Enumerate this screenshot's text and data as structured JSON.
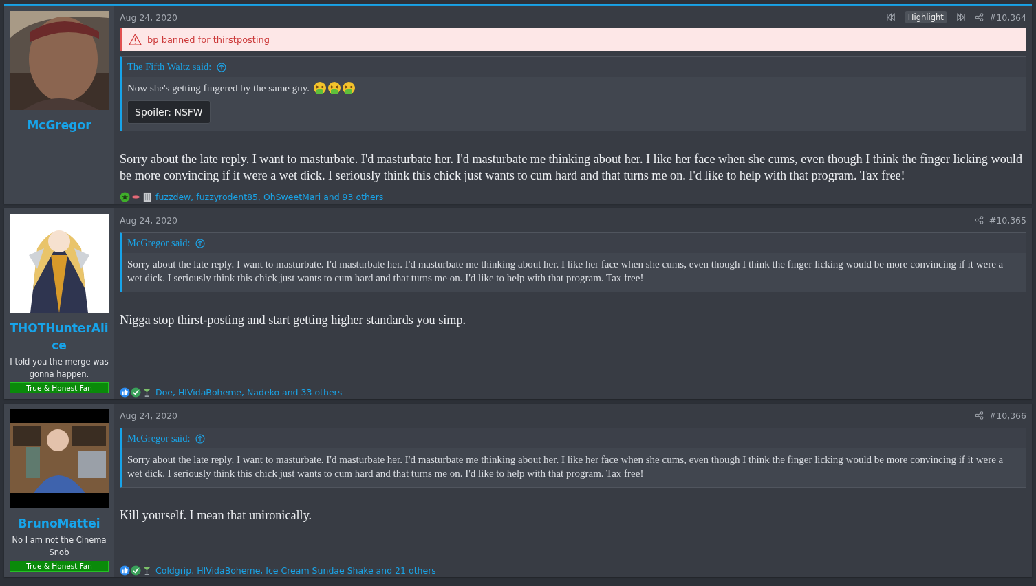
{
  "posts": [
    {
      "user": {
        "name": "McGregor"
      },
      "date": "Aug 24, 2020",
      "highlight": {
        "label": "Highlight"
      },
      "number": "#10,364",
      "notice": {
        "text": "bp banned for thirstposting"
      },
      "quote": {
        "author": "The Fifth Waltz said:",
        "text": "Now she's getting fingered by the same guy.",
        "emojis": [
          {
            "kind": "vomit"
          },
          {
            "kind": "vomit"
          },
          {
            "kind": "vomit"
          }
        ],
        "spoiler": "Spoiler: NSFW"
      },
      "body": "Sorry about the late reply. I want to masturbate. I'd masturbate her. I'd masturbate me thinking about her. I like her face when she cums, even though I think the finger licking would be more convincing if it were a wet dick. I seriously think this chick just wants to cum hard and that turns me on. I'd like to help with that program. Tax free!",
      "reactions": {
        "icons": [
          {
            "kind": "star"
          },
          {
            "kind": "lips"
          },
          {
            "kind": "door"
          }
        ],
        "text": "fuzzdew, fuzzyrodent85, OhSweetMari and 93 others"
      }
    },
    {
      "user": {
        "name": "THOTHunterAlice",
        "title": "I told you the merge was gonna happen.",
        "banner": "True & Honest Fan"
      },
      "date": "Aug 24, 2020",
      "number": "#10,365",
      "quote": {
        "author": "McGregor said:",
        "text": "Sorry about the late reply. I want to masturbate. I'd masturbate her. I'd masturbate me thinking about her. I like her face when she cums, even though I think the finger licking would be more convincing if it were a wet dick. I seriously think this chick just wants to cum hard and that turns me on. I'd like to help with that program. Tax free!"
      },
      "body": "Nigga stop thirst-posting and start getting higher standards you simp.",
      "reactions": {
        "icons": [
          {
            "kind": "like"
          },
          {
            "kind": "check"
          },
          {
            "kind": "cocktail"
          }
        ],
        "text": "Doe, HIVidaBoheme, Nadeko and 33 others"
      }
    },
    {
      "user": {
        "name": "BrunoMattei",
        "title": "No I am not the Cinema Snob",
        "banner": "True & Honest Fan"
      },
      "date": "Aug 24, 2020",
      "number": "#10,366",
      "quote": {
        "author": "McGregor said:",
        "text": "Sorry about the late reply. I want to masturbate. I'd masturbate her. I'd masturbate me thinking about her. I like her face when she cums, even though I think the finger licking would be more convincing if it were a wet dick. I seriously think this chick just wants to cum hard and that turns me on. I'd like to help with that program. Tax free!"
      },
      "body": "Kill yourself. I mean that unironically.",
      "reactions": {
        "icons": [
          {
            "kind": "like"
          },
          {
            "kind": "check"
          },
          {
            "kind": "cocktail"
          }
        ],
        "text": "Coldgrip, HIVidaBoheme, Ice Cream Sundae Shake and 21 others"
      }
    }
  ]
}
